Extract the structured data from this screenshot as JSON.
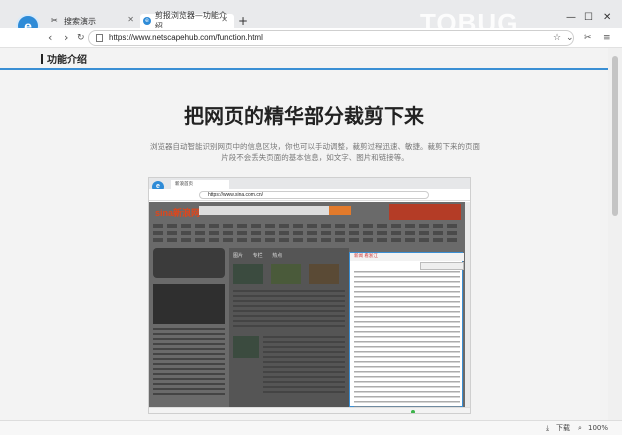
{
  "browser": {
    "tabs": [
      {
        "label": "搜索演示",
        "active": false
      },
      {
        "label": "剪报浏览器—功能介绍",
        "active": true
      }
    ],
    "new_tab": "+",
    "window_controls": {
      "minimize": "—",
      "maximize": "☐",
      "close": "✕"
    },
    "watermark": "TOBUG",
    "address": "https://www.netscapehub.com/function.html"
  },
  "page": {
    "section_title": "功能介绍",
    "headline": "把网页的精华部分裁剪下来",
    "description": "浏览器自动智能识别网页中的信息区块，你也可以手动调整，裁剪过程迅速、敏捷。裁剪下来的页面片段不会丢失页面的基本信息，如文字、图片和链接等。"
  },
  "screenshot": {
    "tab_label": "新浪首页",
    "address": "https://www.sina.com.cn/",
    "logo_text": "sina新浪网",
    "panel_tabs": [
      "图片",
      "专栏",
      "热点"
    ],
    "selection_header": "新闻   看浙江"
  },
  "statusbar": {
    "download": "下载",
    "zoom": "100%"
  },
  "colors": {
    "accent": "#3a8fd4",
    "page_bg": "#f3f3f3"
  }
}
